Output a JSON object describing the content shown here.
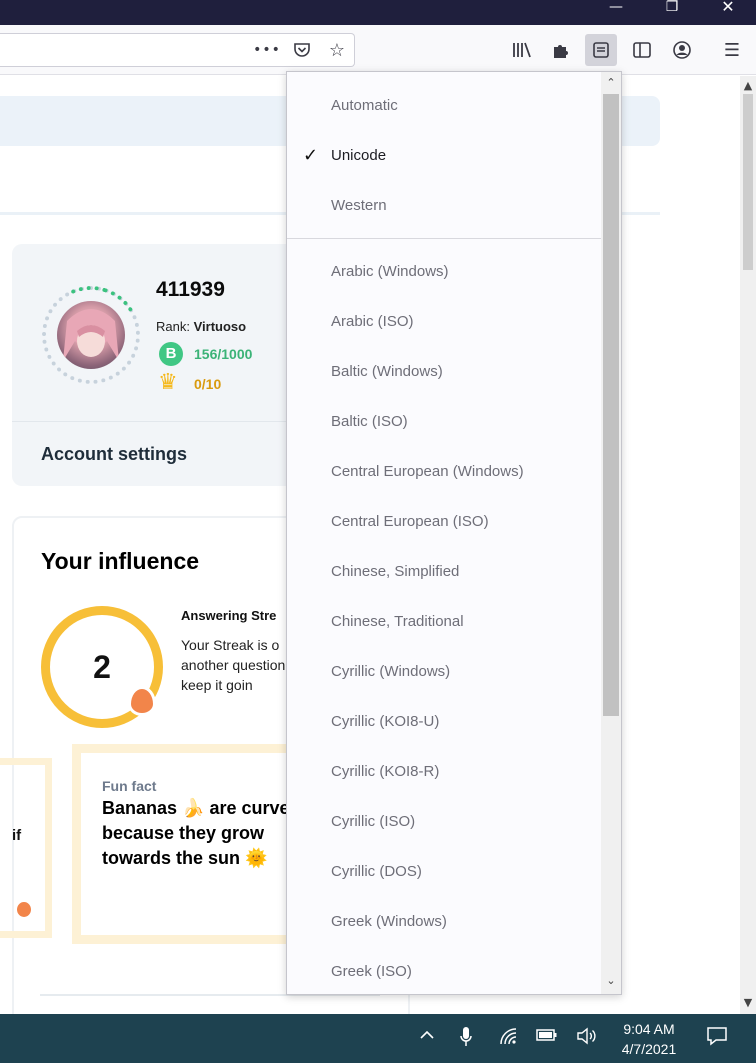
{
  "browser": {
    "toolbar_icons": [
      "ellipsis-icon",
      "pocket-icon",
      "star-icon",
      "library-icon",
      "extensions-icon",
      "text-encoding-icon",
      "sidebar-icon",
      "account-icon",
      "menu-icon"
    ],
    "url_more_label": "•••"
  },
  "profile": {
    "username": "411939",
    "rank_label": "Rank:",
    "rank_value": "Virtuoso",
    "points_icon_letter": "B",
    "points": "156/1000",
    "crowns": "0/10",
    "account_settings": "Account settings"
  },
  "influence": {
    "title": "Your influence",
    "streak_count": "2",
    "streak_title": "Answering Stre",
    "streak_body": "Your Streak is o another question and keep it goin",
    "partial_left_text": "if",
    "fact_label": "Fun fact",
    "fact_line1": "Bananas 🍌 are curve",
    "fact_line2": "because they grow",
    "fact_line3": "towards the sun 🌞"
  },
  "encoding_menu": {
    "top_items": [
      "Automatic",
      "Unicode",
      "Western"
    ],
    "checked": "Unicode",
    "checkmark": "✓",
    "items": [
      "Arabic (Windows)",
      "Arabic (ISO)",
      "Baltic (Windows)",
      "Baltic (ISO)",
      "Central European (Windows)",
      "Central European (ISO)",
      "Chinese, Simplified",
      "Chinese, Traditional",
      "Cyrillic (Windows)",
      "Cyrillic (KOI8-U)",
      "Cyrillic (KOI8-R)",
      "Cyrillic (ISO)",
      "Cyrillic (DOS)",
      "Greek (Windows)",
      "Greek (ISO)"
    ]
  },
  "taskbar": {
    "time": "9:04 AM",
    "date": "4/7/2021",
    "tray_icons": [
      "chevron-up-icon",
      "microphone-icon",
      "wifi-icon",
      "battery-icon",
      "volume-icon",
      "notifications-icon"
    ]
  },
  "colors": {
    "title_bar": "#1f1f3d",
    "taskbar": "#1e4250",
    "points_green": "#3bb377",
    "crown_gold": "#d99b0f",
    "streak_ring": "#f7bf38",
    "fact_border": "#fdf1d5"
  }
}
